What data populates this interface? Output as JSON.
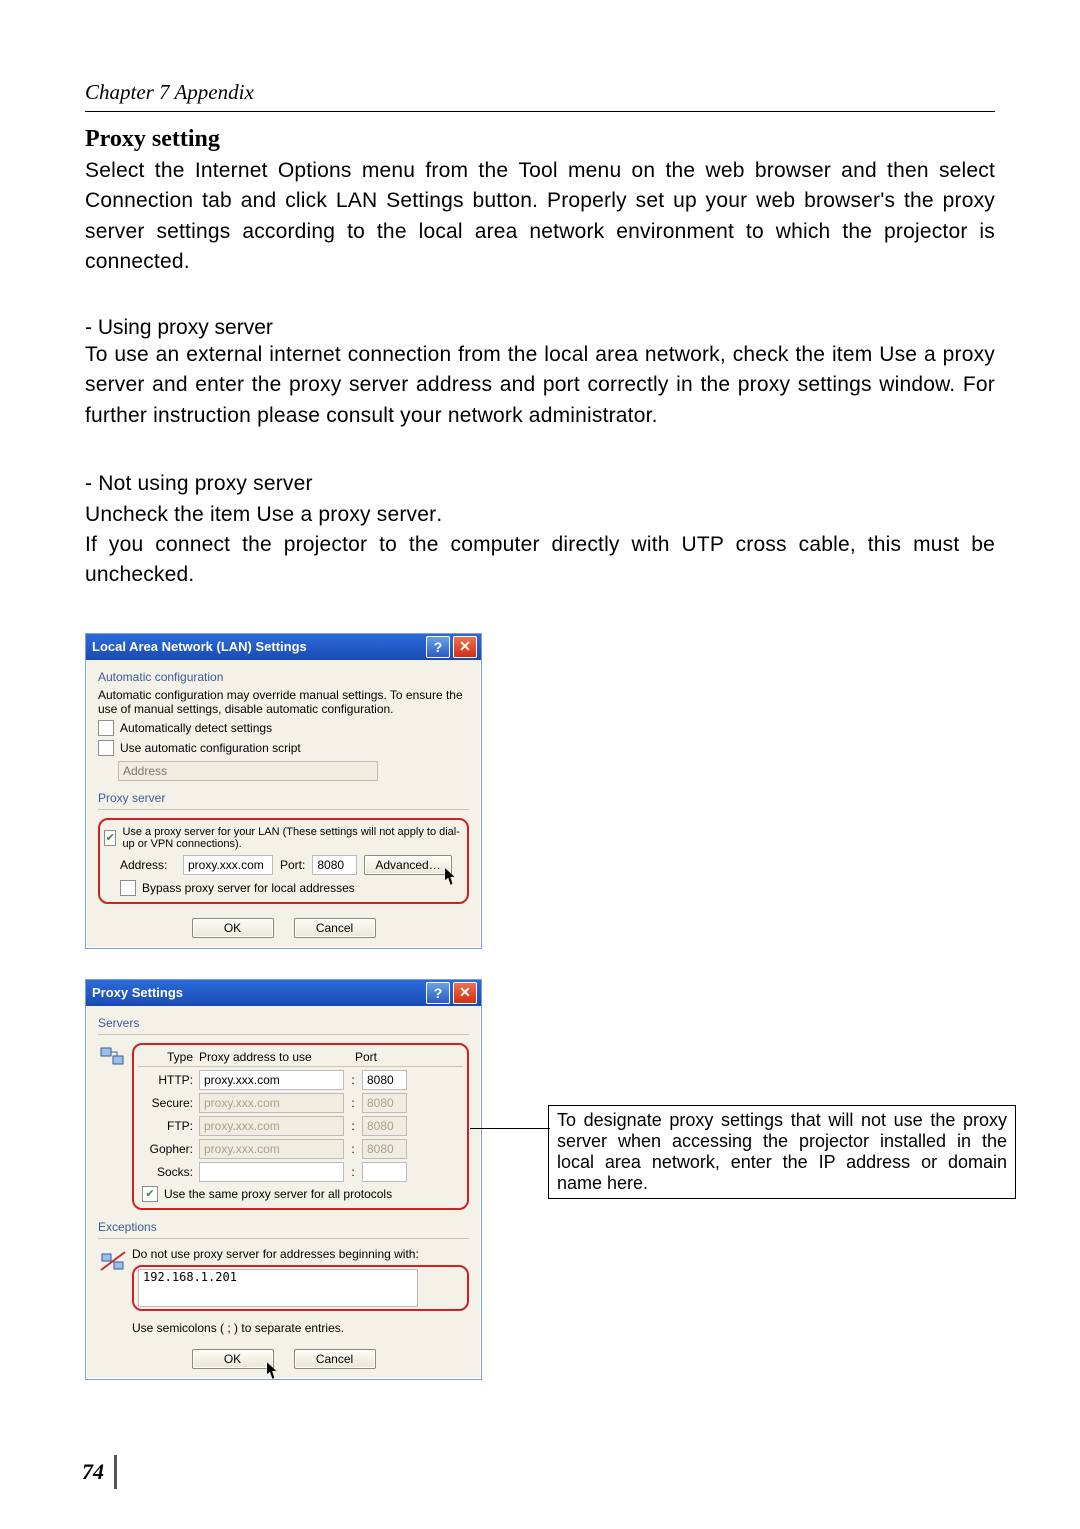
{
  "chapter": "Chapter 7 Appendix",
  "section_title": "Proxy setting",
  "intro": {
    "p1a": "Select the ",
    "b1": "Internet Options",
    "p1b": " menu from the ",
    "b2": "Tool",
    "p1c": " menu on the web browser and then select ",
    "b3": "Connection",
    "p1d": " tab and click ",
    "b4": "LAN Settings",
    "p1e": " button. Properly set up your web browser's the proxy server settings according to the local area network environment to which the projector is connected."
  },
  "using_head": "- Using proxy server",
  "using": {
    "a": "To use an external internet connection from the local area network, check the item ",
    "b": "Use a proxy server",
    "c": " and enter the proxy server address and port correctly in the proxy settings window. For further instruction please consult your network administrator."
  },
  "notusing_head": "- Not using proxy server",
  "notusing": {
    "a": "Uncheck the item ",
    "b": "Use a proxy server",
    "c": ".",
    "d": "If you connect the projector to the computer directly with UTP cross cable, this must be unchecked."
  },
  "lan_dialog": {
    "title": "Local Area Network (LAN) Settings",
    "auto_head": "Automatic configuration",
    "auto_text": "Automatic configuration may override manual settings. To ensure the use of manual settings, disable automatic configuration.",
    "auto_detect": "Automatically detect settings",
    "auto_script": "Use automatic configuration script",
    "address_ph": "Address",
    "proxy_head": "Proxy server",
    "proxy_use": "Use a proxy server for your LAN (These settings will not apply to dial-up or VPN connections).",
    "addr_label": "Address:",
    "addr_value": "proxy.xxx.com",
    "port_label": "Port:",
    "port_value": "8080",
    "advanced": "Advanced…",
    "bypass": "Bypass proxy server for local addresses",
    "ok": "OK",
    "cancel": "Cancel"
  },
  "proxy_dialog": {
    "title": "Proxy Settings",
    "servers": "Servers",
    "col_type": "Type",
    "col_addr": "Proxy address to use",
    "col_port": "Port",
    "rows": {
      "http": {
        "label": "HTTP:",
        "addr": "proxy.xxx.com",
        "port": "8080"
      },
      "secure": {
        "label": "Secure:",
        "addr": "proxy.xxx.com",
        "port": "8080"
      },
      "ftp": {
        "label": "FTP:",
        "addr": "proxy.xxx.com",
        "port": "8080"
      },
      "gopher": {
        "label": "Gopher:",
        "addr": "proxy.xxx.com",
        "port": "8080"
      },
      "socks": {
        "label": "Socks:",
        "addr": "",
        "port": ""
      }
    },
    "same": "Use the same proxy server for all protocols",
    "exceptions": "Exceptions",
    "except_text": "Do not use proxy server for addresses beginning with:",
    "except_value": "192.168.1.201",
    "semi": "Use semicolons ( ; ) to separate entries.",
    "ok": "OK",
    "cancel": "Cancel"
  },
  "callout": "To designate proxy settings that will not use the proxy server when accessing the projector installed in the local area network, enter the IP address or domain name here.",
  "page_number": "74"
}
